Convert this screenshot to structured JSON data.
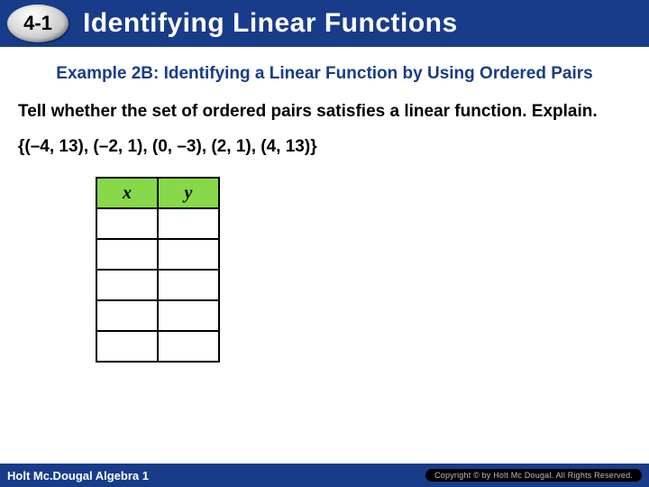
{
  "header": {
    "section_number": "4-1",
    "title": "Identifying Linear Functions"
  },
  "example": {
    "heading": "Example 2B: Identifying a Linear Function by Using Ordered Pairs",
    "instruction": "Tell whether the set of ordered pairs satisfies a linear function. Explain.",
    "pairs": "{(–4, 13), (–2, 1), (0, –3), (2, 1), (4, 13)}"
  },
  "table": {
    "col_x": "x",
    "col_y": "y"
  },
  "footer": {
    "publisher": "Holt Mc.Dougal Algebra 1",
    "copyright": "Copyright © by Holt Mc Dougal. All Rights Reserved."
  }
}
